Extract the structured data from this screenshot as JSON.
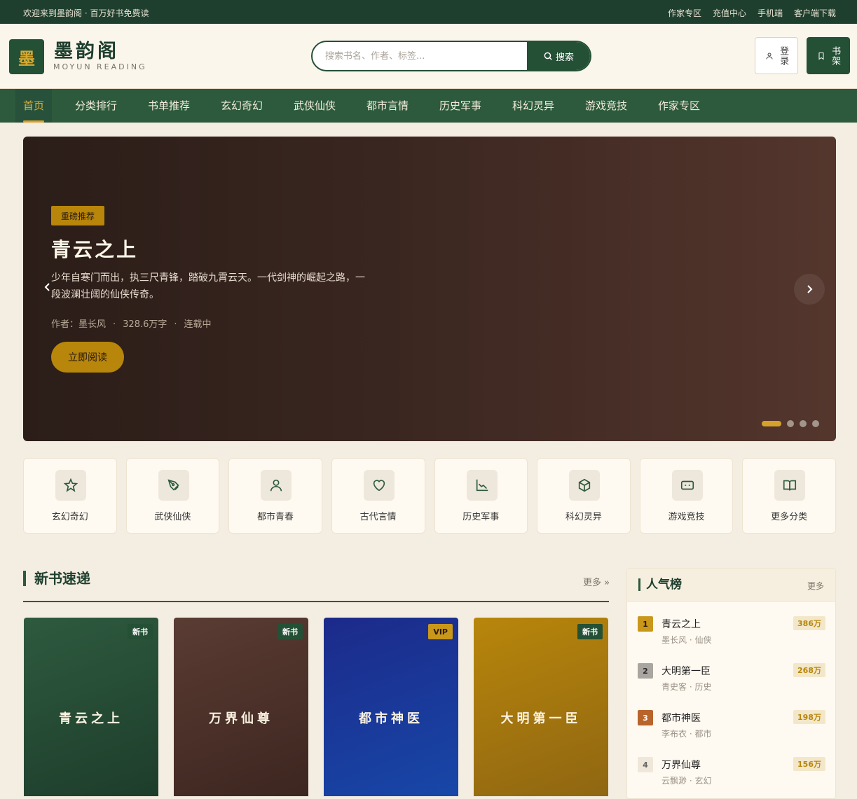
{
  "topbar": {
    "welcome": "欢迎来到墨韵阁 · 百万好书免费读",
    "links": [
      "作家专区",
      "充值中心",
      "手机端",
      "客户端下载"
    ]
  },
  "header": {
    "logo_char": "墨",
    "site_name": "墨韵阁",
    "site_sub": "MOYUN READING",
    "search_placeholder": "搜索书名、作者、标签...",
    "search_button": "搜索",
    "login_label": "登录",
    "shelf_label": "书架"
  },
  "nav": {
    "items": [
      "首页",
      "分类排行",
      "书单推荐",
      "玄幻奇幻",
      "武侠仙侠",
      "都市言情",
      "历史军事",
      "科幻灵异",
      "游戏竞技",
      "作家专区"
    ],
    "active_index": 0
  },
  "banner": {
    "tag": "重磅推荐",
    "title": "青云之上",
    "desc": "少年自寒门而出，执三尺青锋，踏破九霄云天。一代剑神的崛起之路，一段波澜壮阔的仙侠传奇。",
    "author": "作者：墨长风",
    "words": "328.6万字",
    "status": "连载中",
    "read_button": "立即阅读",
    "slide_count": 4,
    "active_slide": 0
  },
  "categories": [
    {
      "label": "玄幻奇幻",
      "icon": "star-icon"
    },
    {
      "label": "武侠仙侠",
      "icon": "pen-nib-icon"
    },
    {
      "label": "都市青春",
      "icon": "user-icon"
    },
    {
      "label": "古代言情",
      "icon": "heart-icon"
    },
    {
      "label": "历史军事",
      "icon": "line-chart-icon"
    },
    {
      "label": "科幻灵异",
      "icon": "cube-icon"
    },
    {
      "label": "游戏竞技",
      "icon": "gamepad-icon"
    },
    {
      "label": "更多分类",
      "icon": "open-book-icon"
    }
  ],
  "new_books": {
    "title": "新书速递",
    "more": "更多 »",
    "books": [
      {
        "name": "青云之上",
        "badge": "新书"
      },
      {
        "name": "万界仙尊",
        "badge": "新书"
      },
      {
        "name": "都市神医",
        "badge": "VIP"
      },
      {
        "name": "大明第一臣",
        "badge": "新书"
      }
    ]
  },
  "ranking": {
    "title": "人气榜",
    "more": "更多",
    "items": [
      {
        "rank": "1",
        "name": "青云之上",
        "sub": "墨长风 · 仙侠",
        "hot": "386万"
      },
      {
        "rank": "2",
        "name": "大明第一臣",
        "sub": "青史客 · 历史",
        "hot": "268万"
      },
      {
        "rank": "3",
        "name": "都市神医",
        "sub": "李布衣 · 都市",
        "hot": "198万"
      },
      {
        "rank": "4",
        "name": "万界仙尊",
        "sub": "云飘渺 · 玄幻",
        "hot": "156万"
      }
    ]
  },
  "colors": {
    "primary": "#1f3f2e",
    "nav": "#2d5a3c",
    "accent": "#b8860b",
    "gold": "#d6a22c",
    "background": "#f4ede1"
  }
}
